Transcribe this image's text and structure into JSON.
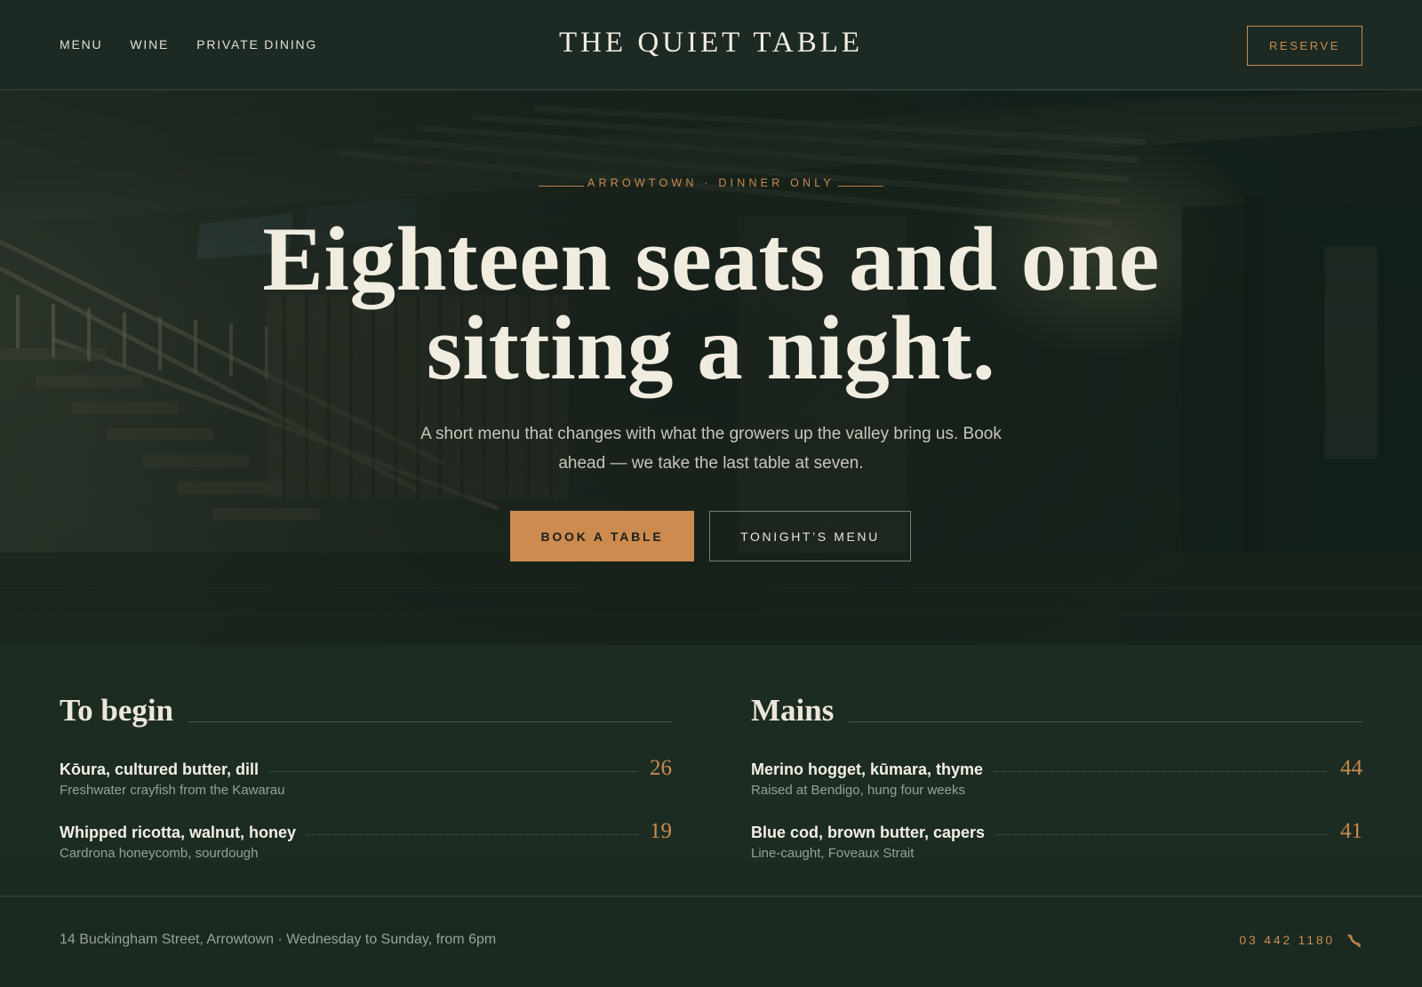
{
  "header": {
    "nav": [
      "MENU",
      "WINE",
      "PRIVATE DINING"
    ],
    "brand": "THE QUIET TABLE",
    "reserve_label": "RESERVE"
  },
  "hero": {
    "eyebrow": "ARROWTOWN · DINNER ONLY",
    "headline_line1": "Eighteen seats and one",
    "headline_line2": "sitting a night.",
    "lede": "A short menu that changes with what the growers up the valley bring us. Book ahead — we take the last table at seven.",
    "primary_cta": "BOOK A TABLE",
    "secondary_cta": "TONIGHT’S MENU"
  },
  "menu": {
    "begin": {
      "title": "To begin",
      "items": [
        {
          "name": "Kōura, cultured butter, dill",
          "desc": "Freshwater crayfish from the Kawarau",
          "price": "26"
        },
        {
          "name": "Whipped ricotta, walnut, honey",
          "desc": "Cardrona honeycomb, sourdough",
          "price": "19"
        }
      ]
    },
    "mains": {
      "title": "Mains",
      "items": [
        {
          "name": "Merino hogget, kūmara, thyme",
          "desc": "Raised at Bendigo, hung four weeks",
          "price": "44"
        },
        {
          "name": "Blue cod, brown butter, capers",
          "desc": "Line-caught, Foveaux Strait",
          "price": "41"
        }
      ]
    }
  },
  "footer": {
    "address": "14 Buckingham Street, Arrowtown · Wednesday to Sunday, from 6pm",
    "phone": "03 442 1180",
    "phone_icon": "phone-icon"
  },
  "colors": {
    "background": "#1a2b22",
    "accent": "#cd8b50",
    "text": "#f1ece0"
  }
}
